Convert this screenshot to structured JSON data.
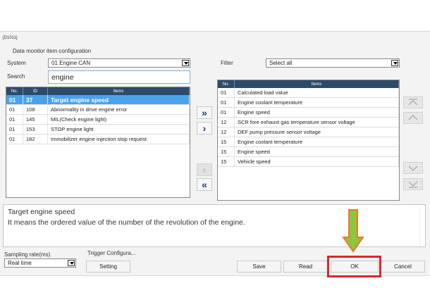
{
  "window": {
    "code": "[D1011]",
    "title": "Data monitor item configuration"
  },
  "system": {
    "label": "System",
    "value": "01  Engine  CAN"
  },
  "search": {
    "label": "Search",
    "value": "engine"
  },
  "filter": {
    "label": "Filter",
    "value": "Select all"
  },
  "left_table": {
    "headers": [
      "No.",
      "ID",
      "Items"
    ],
    "rows": [
      [
        "01",
        "37",
        "Target engine speed"
      ],
      [
        "01",
        "108",
        "Abnormality in drive engine error"
      ],
      [
        "01",
        "145",
        "MIL(Check engine light)"
      ],
      [
        "01",
        "153",
        "STOP engine light"
      ],
      [
        "01",
        "182",
        "Immobilizer engine injection stop request"
      ]
    ]
  },
  "right_table": {
    "headers": [
      "No.",
      "Items"
    ],
    "rows": [
      [
        "01",
        "Calculated load value"
      ],
      [
        "01",
        "Engine coolant temperature"
      ],
      [
        "01",
        "Engine speed"
      ],
      [
        "12",
        "SCR fore exhaust gas temperature sensor voltage"
      ],
      [
        "12",
        "DEF pump pressure sensor voltage"
      ],
      [
        "15",
        "Engine coolant temperature"
      ],
      [
        "15",
        "Engine speed"
      ],
      [
        "15",
        "Vehicle speed"
      ]
    ]
  },
  "move_buttons": {
    "add_all": "»",
    "add": "›",
    "remove": "‹",
    "remove_all": "«"
  },
  "description": {
    "title": "Target engine speed",
    "text": "It means the ordered value of the number of the revolution of the engine."
  },
  "sampling": {
    "label": "Sampling rate(ms)",
    "value": "Real time"
  },
  "trigger": {
    "label": "Trigger Configura...",
    "button": "Setting"
  },
  "buttons": {
    "save": "Save",
    "read": "Read",
    "ok": "OK",
    "cancel": "Cancel"
  },
  "colors": {
    "header_bg": "#2e4a6b",
    "selected_row": "#4aa3e8",
    "highlight_box": "#d9262b",
    "arrow_fill": "#8cc63e",
    "arrow_stroke": "#e7792a"
  },
  "icons": [
    "chevron-down-icon",
    "double-chevron-right-icon",
    "chevron-right-icon",
    "chevron-left-icon",
    "double-chevron-left-icon",
    "move-top-icon",
    "move-up-icon",
    "move-down-icon",
    "move-bottom-icon",
    "down-arrow-annotation-icon"
  ]
}
